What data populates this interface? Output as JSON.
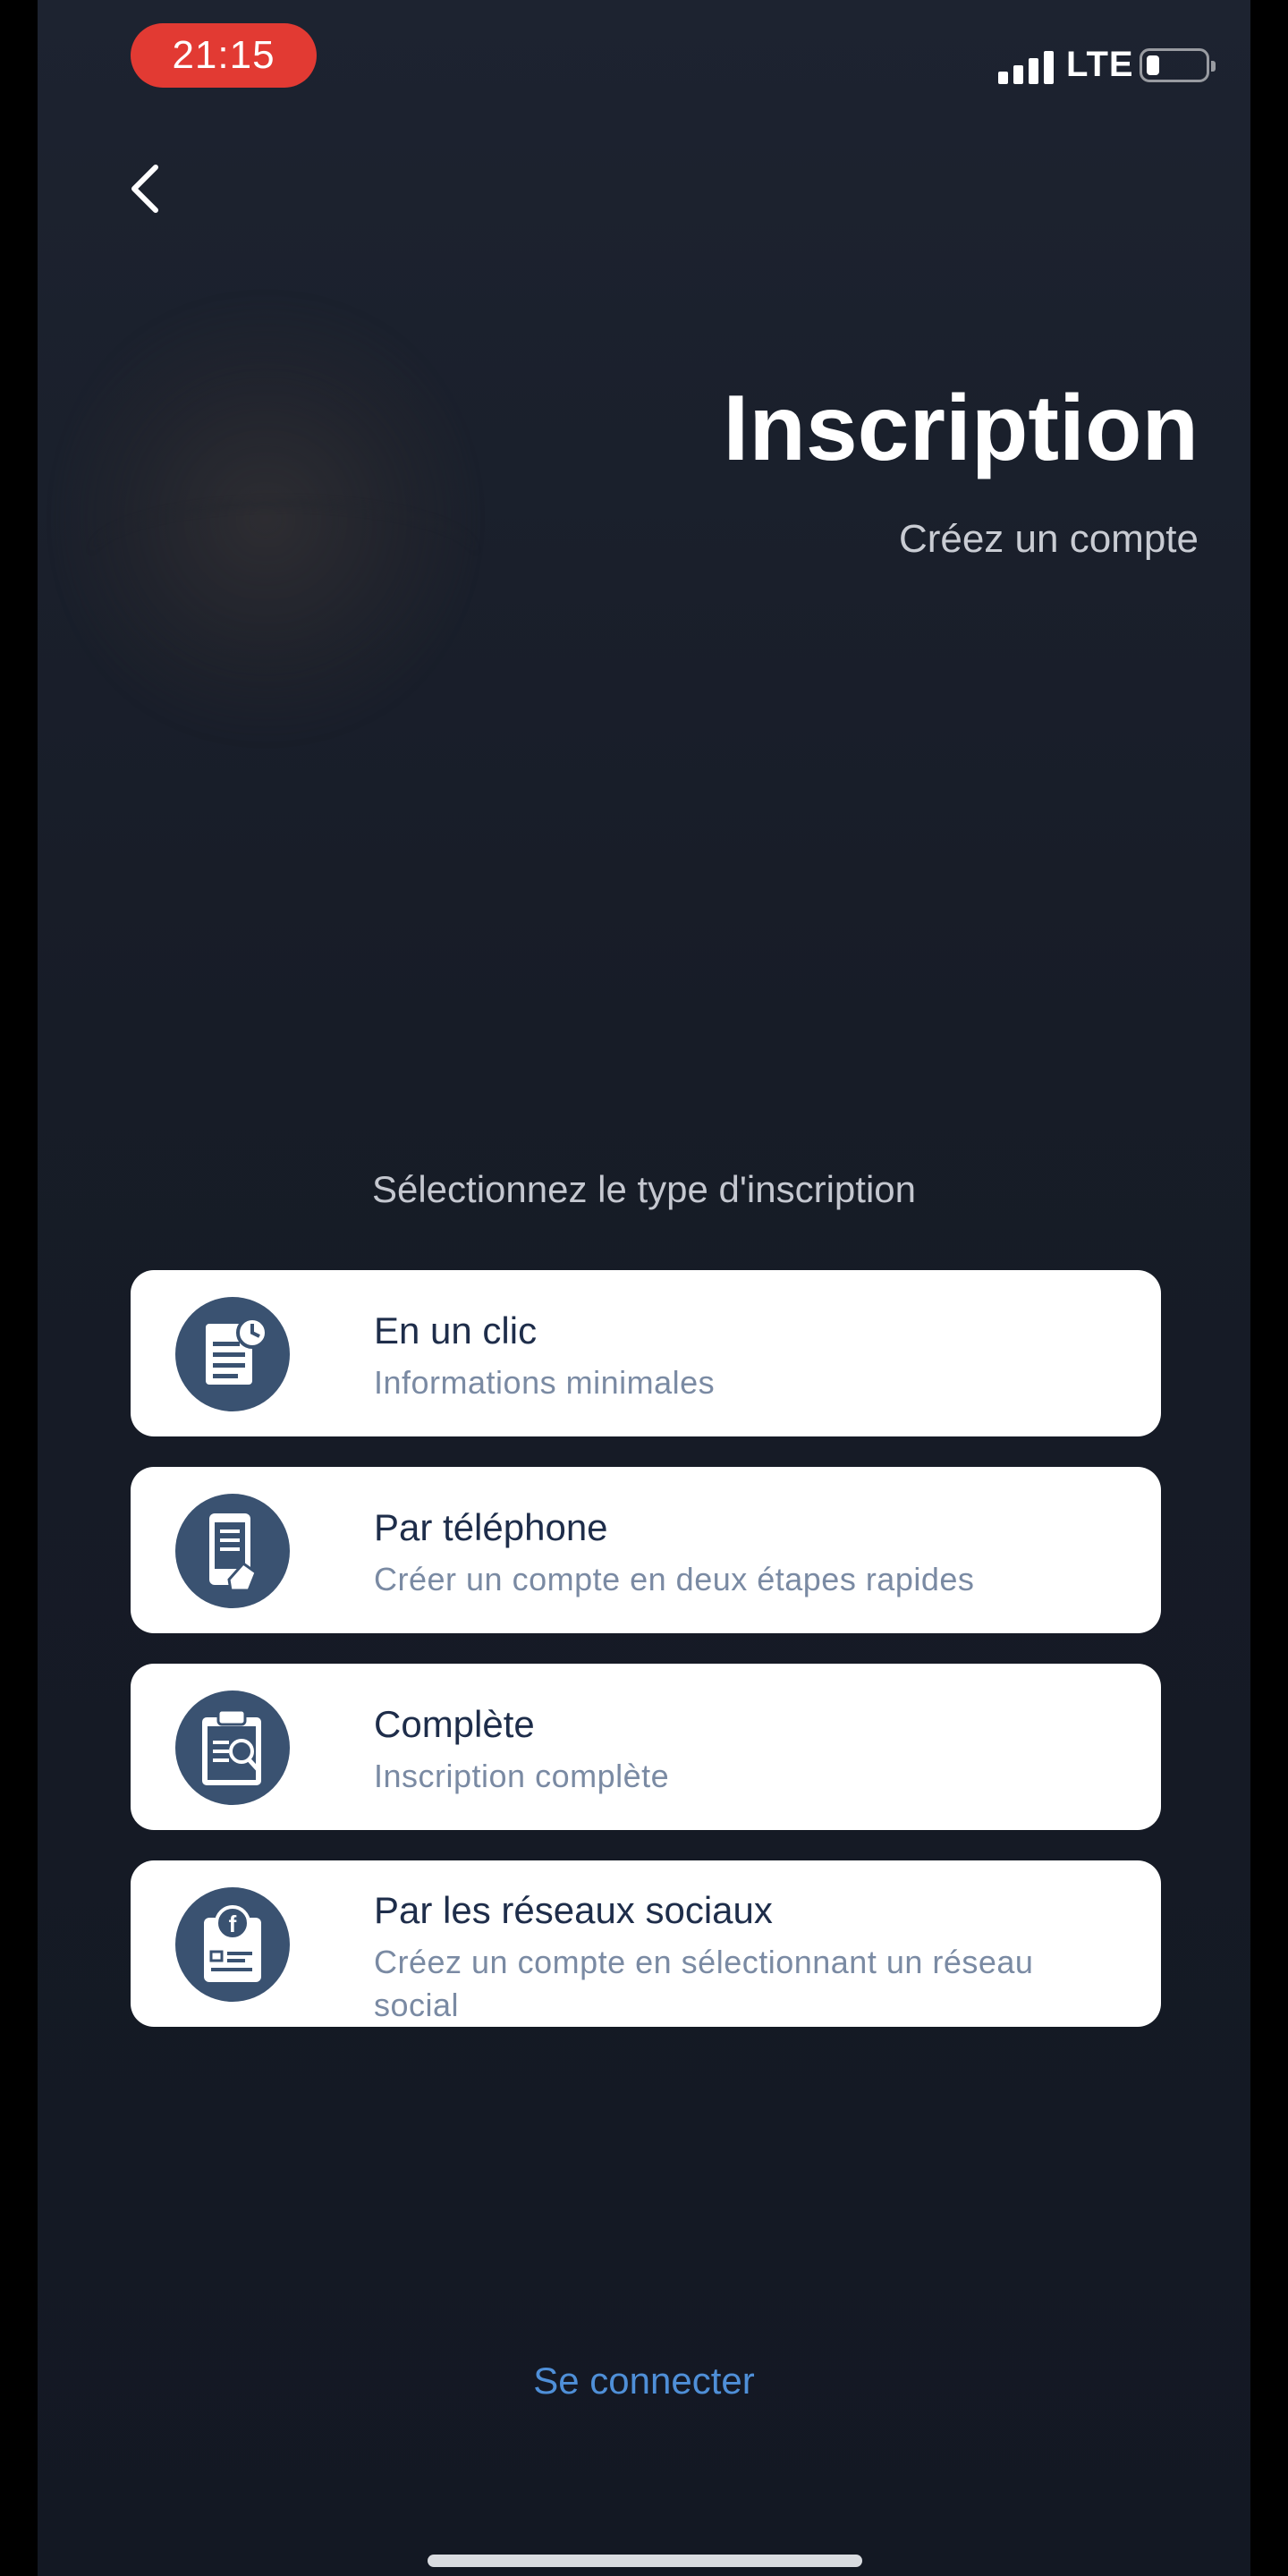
{
  "status_bar": {
    "time": "21:15",
    "network": "LTE"
  },
  "header": {
    "title": "Inscription",
    "subtitle": "Créez un compte"
  },
  "prompt": "Sélectionnez le type d'inscription",
  "options": [
    {
      "label": "En un clic",
      "description": "Informations minimales",
      "icon": "document-clock-icon"
    },
    {
      "label": "Par téléphone",
      "description": "Créer un compte en deux étapes rapides",
      "icon": "phone-hand-icon"
    },
    {
      "label": "Complète",
      "description": "Inscription complète",
      "icon": "clipboard-icon"
    },
    {
      "label": "Par les réseaux sociaux",
      "description": "Créez un compte en sélectionnant un réseau social",
      "icon": "facebook-id-card-icon"
    }
  ],
  "login_link": "Se connecter",
  "colors": {
    "accent": "#4f8fd8",
    "time_pill": "#e23a33",
    "icon_bg": "#3a5271",
    "background": "#171c27"
  }
}
